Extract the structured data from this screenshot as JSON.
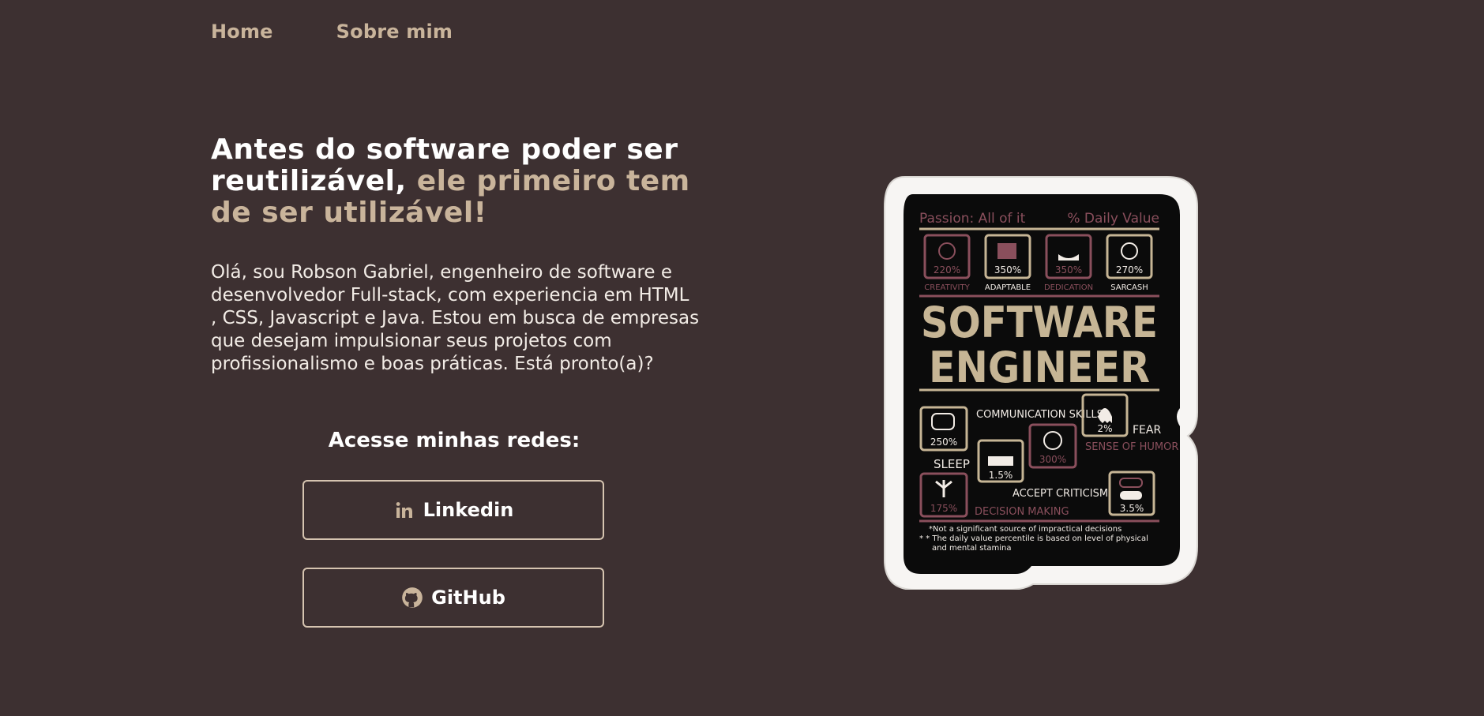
{
  "nav": {
    "items": [
      "Home",
      "Sobre mim"
    ]
  },
  "hero": {
    "title_part1": "Antes do software poder ser reutilizável,",
    "title_part2": " ele primeiro tem de ser utilizável!",
    "intro": "Olá, sou Robson Gabriel, engenheiro de software e desenvolvedor Full-stack, com experiencia em HTML , CSS, Javascript e Java. Estou em busca de empresas que desejam impulsionar seus projetos com profissionalismo e boas práticas. Está pronto(a)?"
  },
  "social": {
    "title": "Acesse minhas redes:",
    "linkedin_label": "Linkedin",
    "github_label": "GitHub"
  },
  "sticker": {
    "header_left": "Passion: All of it",
    "header_right": "% Daily Value",
    "stats_top": [
      {
        "pct": "220%",
        "label": "CREATIVITY"
      },
      {
        "pct": "350%",
        "label": "ADAPTABLE"
      },
      {
        "pct": "350%",
        "label": "DEDICATION"
      },
      {
        "pct": "270%",
        "label": "SARCASH"
      }
    ],
    "title_line1": "SOFTWARE",
    "title_line2": "ENGINEER",
    "communication_label": "COMMUNICATION SKILLS",
    "communication_pct": "250%",
    "fear_pct": "2%",
    "fear_label": "FEAR",
    "humor_pct": "300%",
    "humor_label": "SENSE OF HUMOR",
    "sleep_label": "SLEEP",
    "sleep_pct": "1.5%",
    "decision_pct": "175%",
    "decision_label": "DECISION MAKING",
    "criticism_label": "ACCEPT CRITICISM",
    "criticism_pct": "3.5%",
    "footnote1": "*Not a significant source of impractical decisions",
    "footnote2": "* * The daily value percentile is based on level of physical",
    "footnote3": "and mental stamina"
  },
  "colors": {
    "background": "#3d3031",
    "accent": "#c9b49b",
    "sticker_tan": "#c6b595",
    "sticker_maroon": "#8a4f5c"
  }
}
